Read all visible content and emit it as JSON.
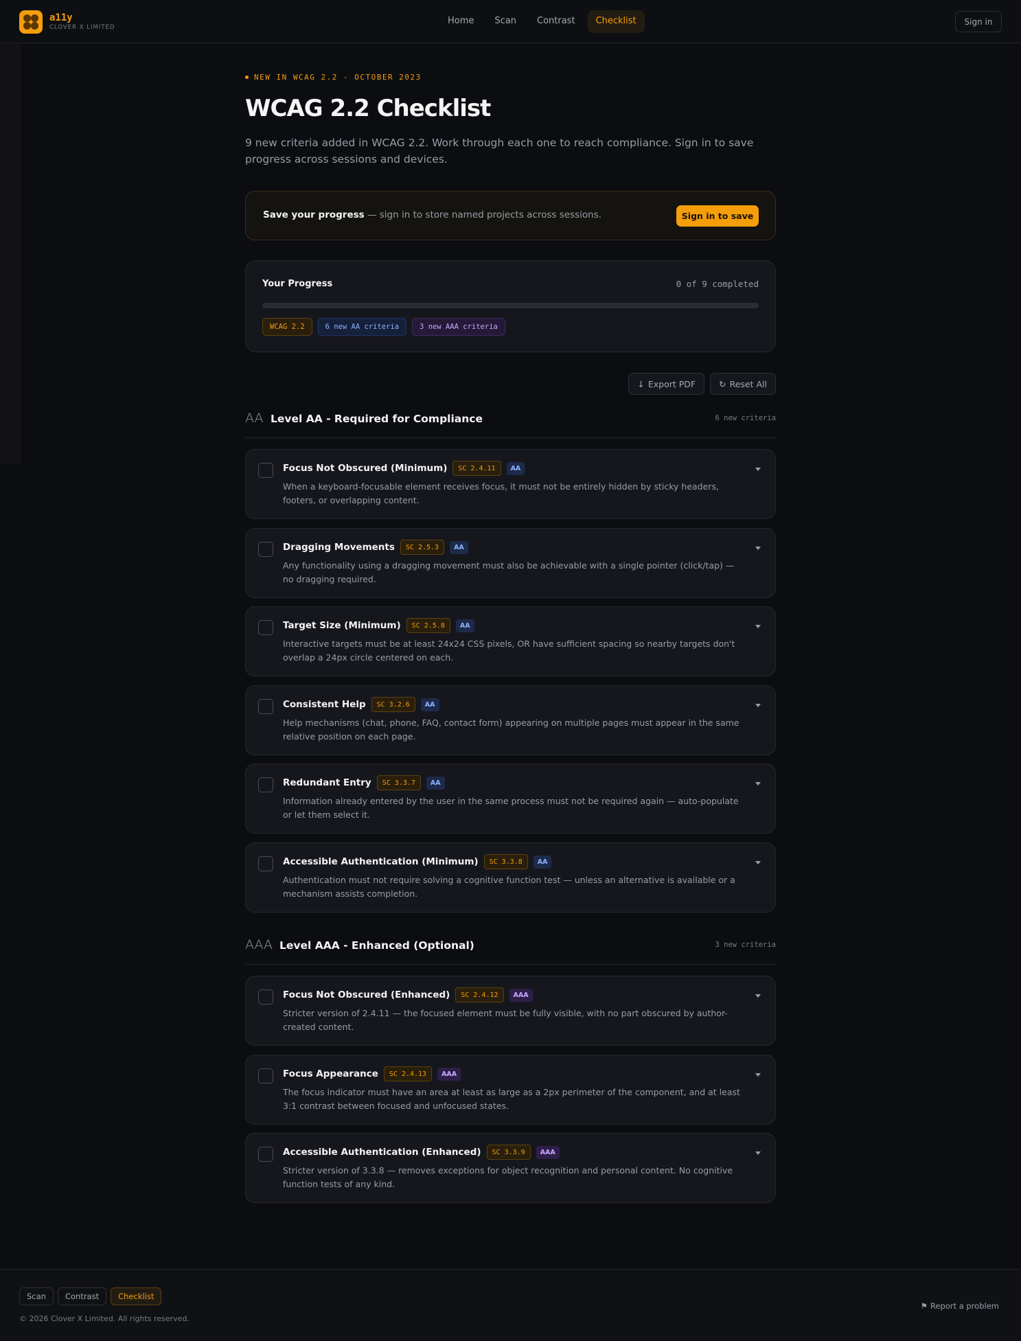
{
  "header": {
    "brand_name": "a11y",
    "brand_sub": "CLOVER X LIMITED",
    "nav": [
      "Home",
      "Scan",
      "Contrast",
      "Checklist"
    ],
    "active_nav": "Checklist",
    "signin_label": "Sign in"
  },
  "hero": {
    "eyebrow": "NEW IN WCAG 2.2 - OCTOBER 2023",
    "title": "WCAG 2.2 Checklist",
    "subtitle": "9 new criteria added in WCAG 2.2. Work through each one to reach compliance. Sign in to save progress across sessions and devices."
  },
  "save_banner": {
    "bold": "Save your progress",
    "rest": " — sign in to store named projects across sessions.",
    "button": "Sign in to save"
  },
  "progress": {
    "label": "Your Progress",
    "count_text": "0 of 9 completed",
    "fraction": 0,
    "chips": [
      "WCAG 2.2",
      "6 new AA criteria",
      "3 new AAA criteria"
    ]
  },
  "actions": {
    "export": "Export PDF",
    "reset": "Reset All"
  },
  "sections": [
    {
      "level": "AA",
      "title": "Level AA - Required for Compliance",
      "count": "6 new criteria",
      "items": [
        {
          "title": "Focus Not Obscured (Minimum)",
          "sc": "SC 2.4.11",
          "level": "AA",
          "desc": "When a keyboard-focusable element receives focus, it must not be entirely hidden by sticky headers, footers, or overlapping content."
        },
        {
          "title": "Dragging Movements",
          "sc": "SC 2.5.3",
          "level": "AA",
          "desc": "Any functionality using a dragging movement must also be achievable with a single pointer (click/tap) — no dragging required."
        },
        {
          "title": "Target Size (Minimum)",
          "sc": "SC 2.5.8",
          "level": "AA",
          "desc": "Interactive targets must be at least 24x24 CSS pixels, OR have sufficient spacing so nearby targets don't overlap a 24px circle centered on each."
        },
        {
          "title": "Consistent Help",
          "sc": "SC 3.2.6",
          "level": "AA",
          "desc": "Help mechanisms (chat, phone, FAQ, contact form) appearing on multiple pages must appear in the same relative position on each page."
        },
        {
          "title": "Redundant Entry",
          "sc": "SC 3.3.7",
          "level": "AA",
          "desc": "Information already entered by the user in the same process must not be required again — auto-populate or let them select it."
        },
        {
          "title": "Accessible Authentication (Minimum)",
          "sc": "SC 3.3.8",
          "level": "AA",
          "desc": "Authentication must not require solving a cognitive function test — unless an alternative is available or a mechanism assists completion."
        }
      ]
    },
    {
      "level": "AAA",
      "title": "Level AAA - Enhanced (Optional)",
      "count": "3 new criteria",
      "items": [
        {
          "title": "Focus Not Obscured (Enhanced)",
          "sc": "SC 2.4.12",
          "level": "AAA",
          "desc": "Stricter version of 2.4.11 — the focused element must be fully visible, with no part obscured by author-created content."
        },
        {
          "title": "Focus Appearance",
          "sc": "SC 2.4.13",
          "level": "AAA",
          "desc": "The focus indicator must have an area at least as large as a 2px perimeter of the component, and at least 3:1 contrast between focused and unfocused states."
        },
        {
          "title": "Accessible Authentication (Enhanced)",
          "sc": "SC 3.3.9",
          "level": "AAA",
          "desc": "Stricter version of 3.3.8 — removes exceptions for object recognition and personal content. No cognitive function tests of any kind."
        }
      ]
    }
  ],
  "footer": {
    "nav": [
      "Scan",
      "Contrast",
      "Checklist"
    ],
    "active_nav": "Checklist",
    "copyright": "© 2026 Clover X Limited. All rights reserved.",
    "report": "Report a problem"
  },
  "colors": {
    "accent": "#f59e0b",
    "background": "#0c0d11",
    "card": "#16171d",
    "aa_badge": "#8fb0ff",
    "aaa_badge": "#c9a8ff"
  }
}
